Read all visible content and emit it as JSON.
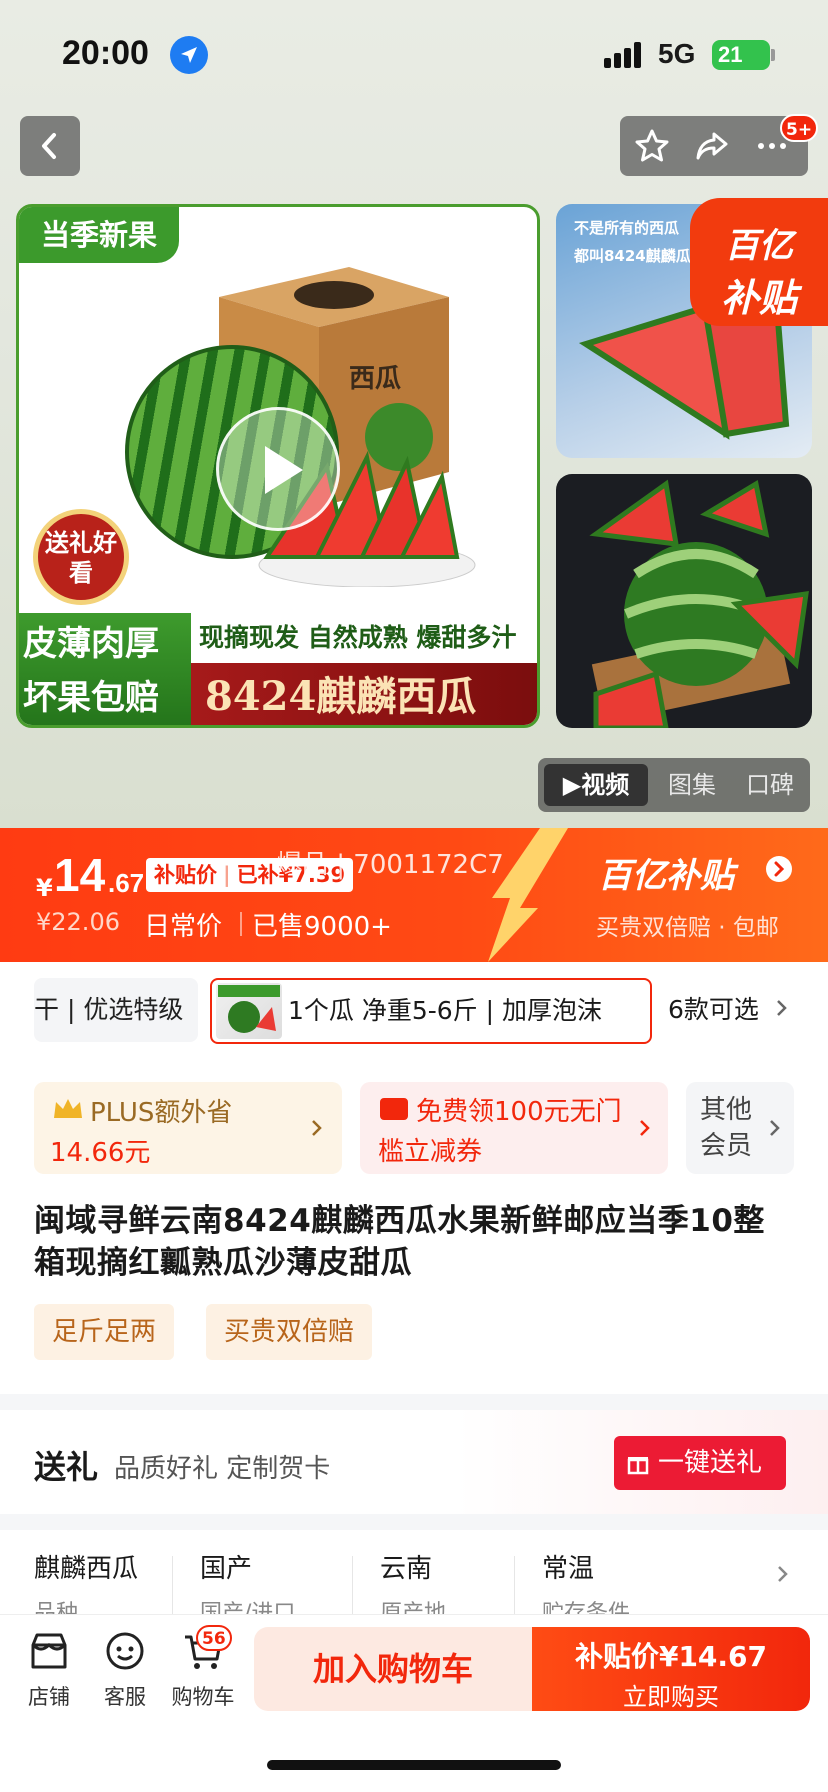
{
  "status_bar": {
    "time": "20:00",
    "network": "5G",
    "battery": "21"
  },
  "nav": {
    "badge": "5+",
    "icons": [
      "back-icon",
      "star-icon",
      "share-icon",
      "more-icon"
    ]
  },
  "gallery": {
    "season_tag": "当季新果",
    "box_label": "西瓜",
    "gift_seal": "送礼好看",
    "banner_left": [
      "皮薄肉厚",
      "坏果包赔"
    ],
    "banner_top": "现摘现发 自然成熟 爆甜多汁",
    "banner_main": "8424麒麟西瓜",
    "side1_caption": [
      "不是所有的西瓜",
      "都叫8424麒麟瓜"
    ],
    "yi_badge": [
      "百亿",
      "补贴"
    ],
    "media_tabs": [
      "视频",
      "图集",
      "口碑"
    ],
    "active_tab": "视频"
  },
  "price": {
    "currency": "¥",
    "integer": "14",
    "decimal": ".67",
    "tag_label": "补贴价",
    "tag_subsidy": "已补¥7.39",
    "watermark": "爆品 | 7001172C7",
    "original": "¥22.06",
    "original_label": "日常价",
    "sold": "已售9000+",
    "program": "百亿补贴",
    "program_sub": "买贵双倍赔 · 包邮"
  },
  "spec": {
    "prev": "干 | 优选特级",
    "current": "1个瓜 净重5-6斤 | 加厚泡沫",
    "more": "6款可选"
  },
  "coupons": {
    "plus_title": "PLUS额外省",
    "plus_amount": "14.66元",
    "free_coupon": "免费领100元无门槛立减券",
    "other": "其他会员"
  },
  "product": {
    "title": "闽域寻鲜云南8424麒麟西瓜水果新鲜邮应当季10整箱现摘红瓤熟瓜沙薄皮甜瓜",
    "service_tags": [
      "足斤足两",
      "买贵双倍赔"
    ]
  },
  "gift": {
    "title": "送礼",
    "subtitle": "品质好礼 定制贺卡",
    "button": "一键送礼"
  },
  "attributes": [
    {
      "value": "麒麟西瓜",
      "key": "品种"
    },
    {
      "value": "国产",
      "key": "国产/进口"
    },
    {
      "value": "云南",
      "key": "原产地"
    },
    {
      "value": "常温",
      "key": "贮存条件"
    }
  ],
  "bottom_bar": {
    "store": "店铺",
    "service": "客服",
    "cart": "购物车",
    "cart_count": "56",
    "add_to_cart": "加入购物车",
    "buy_price_label": "补贴价¥14.67",
    "buy_now": "立即购买"
  },
  "colors": {
    "accent": "#f2270c",
    "green": "#3c9a2c",
    "gold": "#b8651b"
  }
}
